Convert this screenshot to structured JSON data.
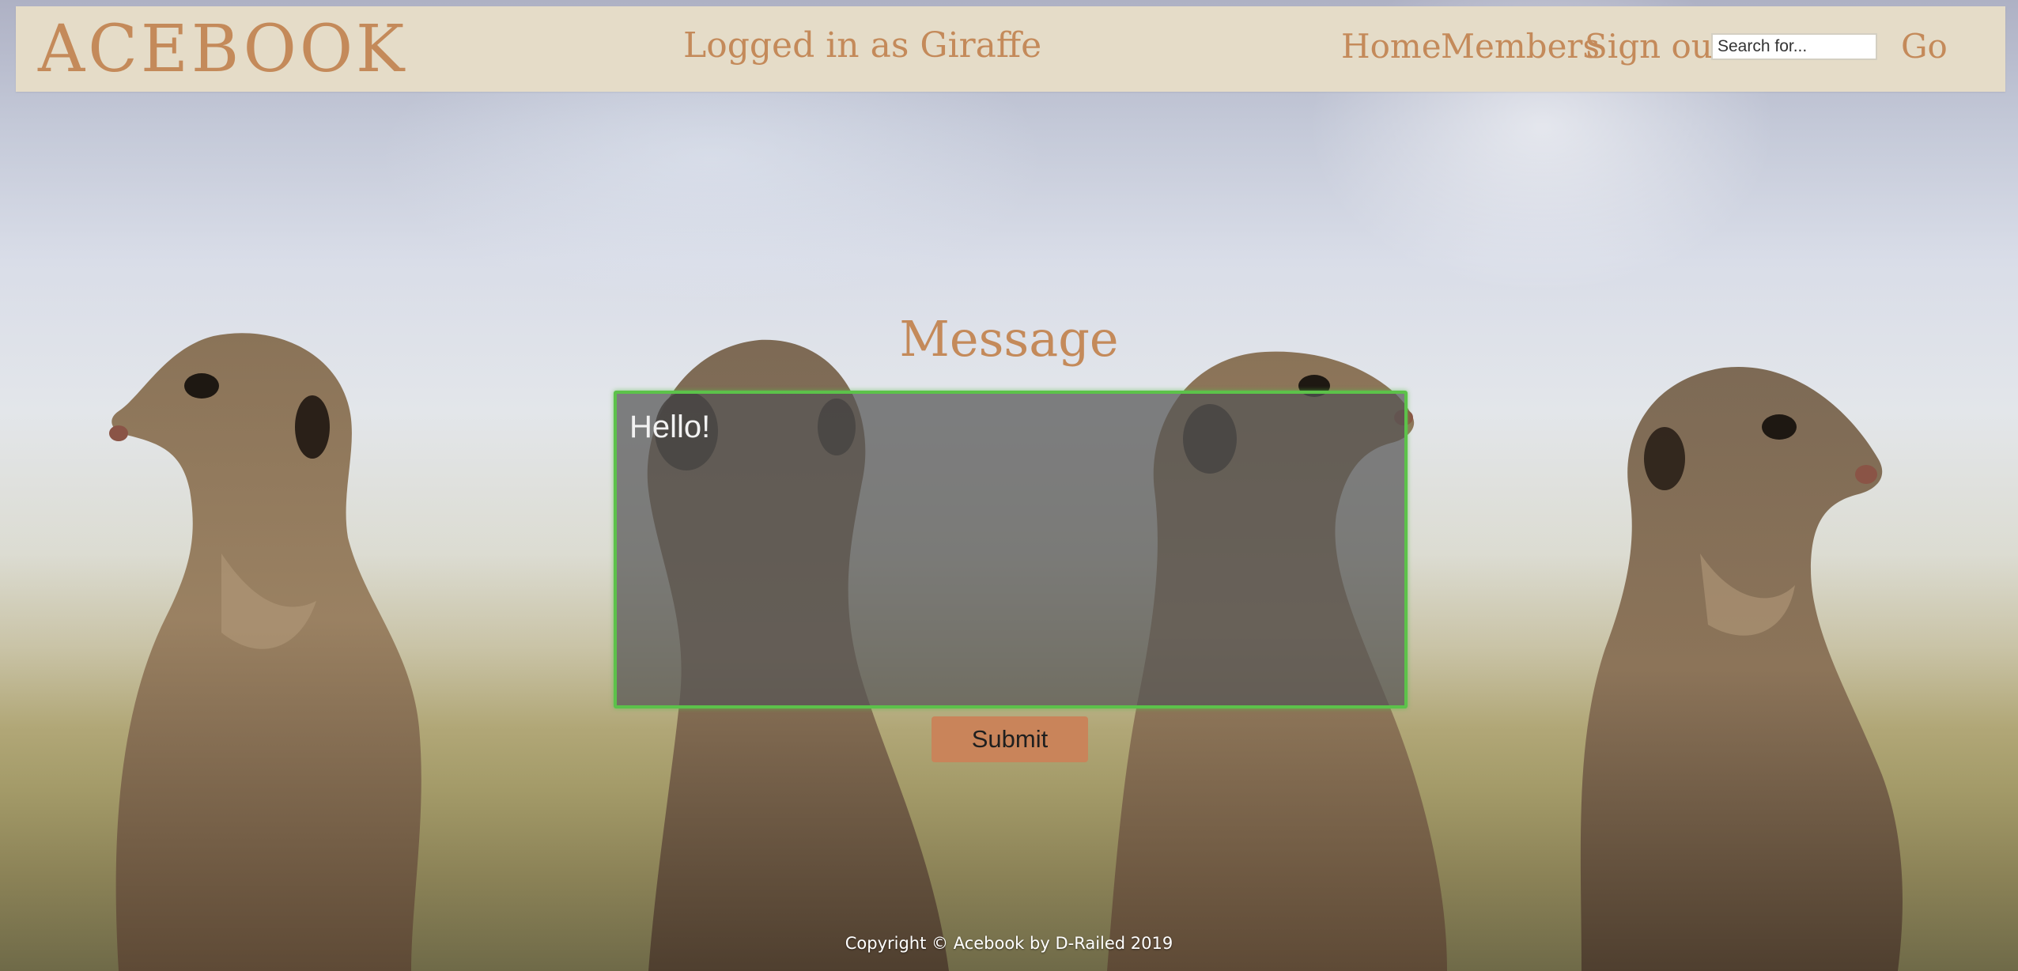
{
  "header": {
    "logo": "ACEBOOK",
    "logged_in_text": "Logged in as Giraffe",
    "nav": {
      "home": "Home",
      "members": "Members",
      "sign_out": "Sign out"
    },
    "search": {
      "placeholder": "Search for...",
      "value": ""
    },
    "go_label": "Go"
  },
  "main": {
    "heading": "Message",
    "message_value": "Hello!",
    "submit_label": "Submit"
  },
  "footer": {
    "text": "Copyright © Acebook by D-Railed 2019"
  },
  "colors": {
    "accent": "#c48a5a",
    "header_bg": "#e5dcc8",
    "textarea_border": "#5cc24a",
    "submit_bg": "#c9845a"
  },
  "background": {
    "image_subject": "meerkats-photo"
  }
}
